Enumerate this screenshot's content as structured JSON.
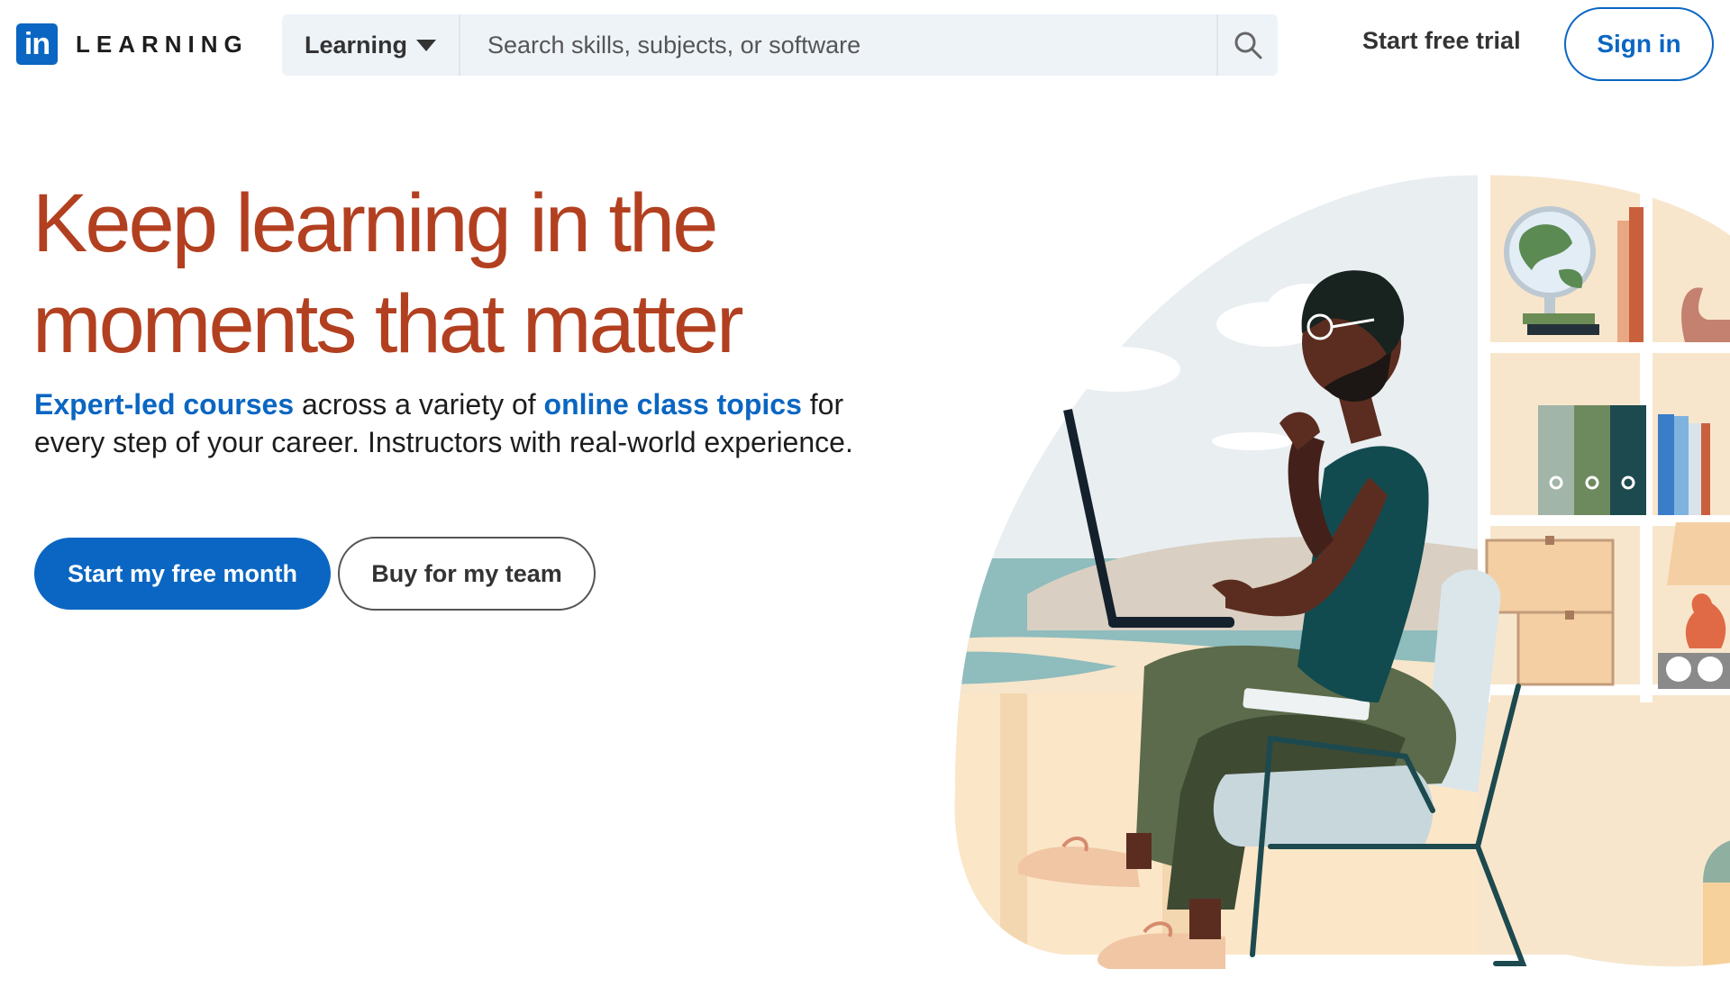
{
  "header": {
    "logo_badge": "in",
    "logo_word": "LEARNING",
    "search": {
      "scope_label": "Learning",
      "placeholder": "Search skills, subjects, or software"
    },
    "trial_link": "Start free trial",
    "signin_label": "Sign in"
  },
  "hero": {
    "title": "Keep learning in the moments that matter",
    "subtitle": {
      "link1": "Expert-led courses",
      "text1": " across a variety of ",
      "link2": "online class topics",
      "text2": " for every step of your career. Instructors with real-world experience."
    },
    "cta_primary": "Start my free month",
    "cta_secondary": "Buy for my team"
  },
  "colors": {
    "brand_blue": "#0a66c2",
    "title_rust": "#b24020",
    "search_bg": "#eef3f8"
  },
  "icons": {
    "search": "search-icon",
    "dropdown": "caret-down-icon"
  }
}
